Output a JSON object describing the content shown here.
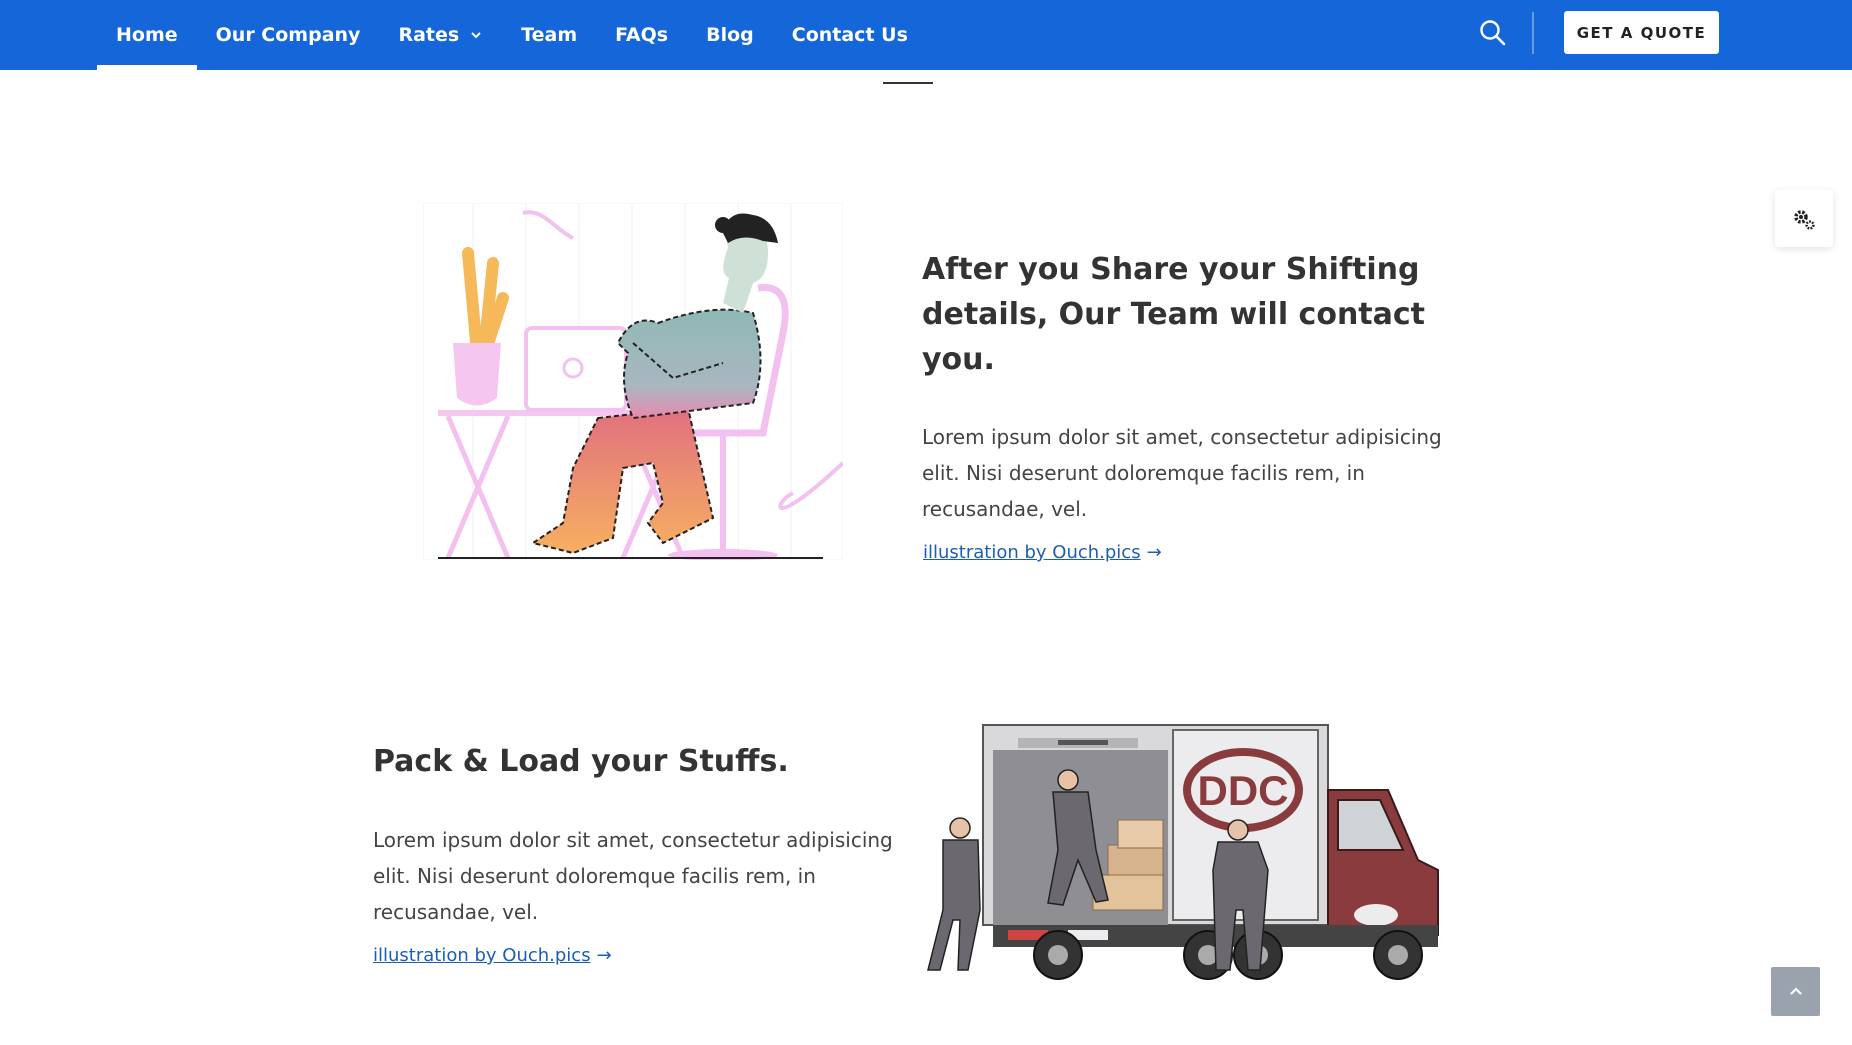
{
  "nav": {
    "items": [
      {
        "label": "Home",
        "active": true
      },
      {
        "label": "Our Company"
      },
      {
        "label": "Rates",
        "has_dropdown": true
      },
      {
        "label": "Team"
      },
      {
        "label": "FAQs"
      },
      {
        "label": "Blog"
      },
      {
        "label": "Contact Us"
      }
    ],
    "quote_label": "GET A QUOTE"
  },
  "section1": {
    "heading_lines": [
      "After you Share your Shifting",
      "details, Our Team will contact",
      "you."
    ],
    "body_lines": [
      "Lorem ipsum dolor sit amet, consectetur adipisicing",
      "elit. Nisi deserunt doloremque facilis rem, in",
      "recusandae, vel."
    ],
    "credit": "illustration by Ouch.pics"
  },
  "section2": {
    "heading": "Pack & Load your Stuffs.",
    "body_lines": [
      "Lorem ipsum dolor sit amet, consectetur adipisicing",
      "elit. Nisi deserunt doloremque facilis rem, in",
      "recusandae, vel."
    ],
    "credit": "illustration by Ouch.pics",
    "truck_logo": "DDC"
  },
  "colors": {
    "nav_bg": "#1466d9",
    "link": "#1b5fb5",
    "heading": "#333333",
    "truck_red": "#8a3b3e"
  },
  "icons": {
    "search": "search-icon",
    "dropdown": "chevron-down-icon",
    "settings": "gears-icon",
    "back_to_top": "chevron-up-icon",
    "credit_arrow": "arrow-right-icon"
  }
}
